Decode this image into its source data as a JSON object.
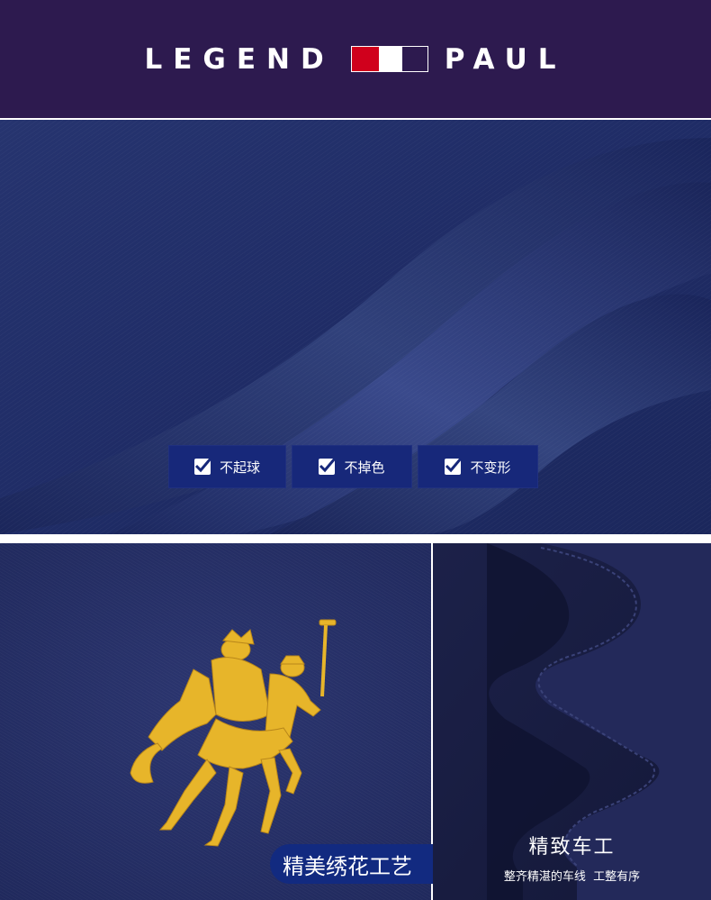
{
  "header": {
    "brand_left": "LEGEND",
    "brand_right": "PAUL",
    "flag_colors": [
      "#d0001c",
      "#ffffff",
      "#2d1a4f"
    ],
    "background": "#2d1a4f"
  },
  "hero": {
    "features": [
      {
        "icon": "checkbox-icon",
        "label": "不起球"
      },
      {
        "icon": "checkbox-icon",
        "label": "不掉色"
      },
      {
        "icon": "checkbox-icon",
        "label": "不变形"
      }
    ],
    "fabric_color": "#22306e"
  },
  "embroidery_panel": {
    "caption": "精美绣花工艺",
    "thread_color": "#e7b52a"
  },
  "stitching_panel": {
    "title": "精致车工",
    "subtitle": "整齐精湛的车线  工整有序"
  }
}
